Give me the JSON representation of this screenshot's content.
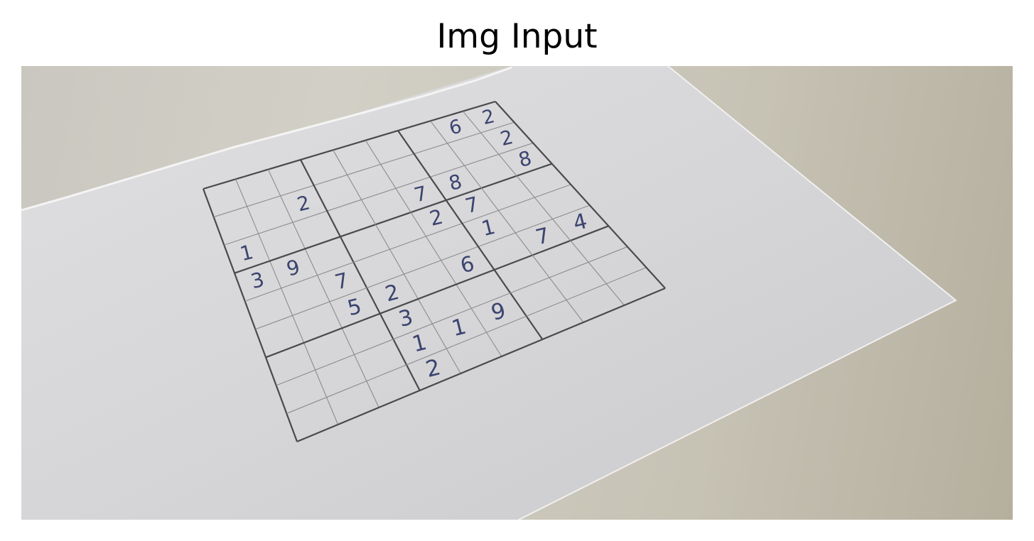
{
  "title": "Img Input",
  "photo": {
    "subject": "hand-written sudoku grid on a sheet of paper",
    "cells": [
      {
        "row": 1,
        "col": 8,
        "value": "6"
      },
      {
        "row": 1,
        "col": 9,
        "value": "2"
      },
      {
        "row": 2,
        "col": 3,
        "value": "2"
      },
      {
        "row": 2,
        "col": 9,
        "value": "2"
      },
      {
        "row": 3,
        "col": 1,
        "value": "1"
      },
      {
        "row": 3,
        "col": 6,
        "value": "7"
      },
      {
        "row": 3,
        "col": 7,
        "value": "8"
      },
      {
        "row": 3,
        "col": 9,
        "value": "8"
      },
      {
        "row": 4,
        "col": 1,
        "value": "3"
      },
      {
        "row": 4,
        "col": 2,
        "value": "9"
      },
      {
        "row": 4,
        "col": 6,
        "value": "2"
      },
      {
        "row": 4,
        "col": 7,
        "value": "7"
      },
      {
        "row": 5,
        "col": 3,
        "value": "7"
      },
      {
        "row": 5,
        "col": 7,
        "value": "1"
      },
      {
        "row": 6,
        "col": 3,
        "value": "5"
      },
      {
        "row": 6,
        "col": 4,
        "value": "2"
      },
      {
        "row": 6,
        "col": 6,
        "value": "6"
      },
      {
        "row": 6,
        "col": 8,
        "value": "7"
      },
      {
        "row": 6,
        "col": 9,
        "value": "4"
      },
      {
        "row": 7,
        "col": 4,
        "value": "3"
      },
      {
        "row": 8,
        "col": 4,
        "value": "1"
      },
      {
        "row": 8,
        "col": 5,
        "value": "1"
      },
      {
        "row": 8,
        "col": 6,
        "value": "9"
      },
      {
        "row": 9,
        "col": 4,
        "value": "2"
      }
    ]
  }
}
